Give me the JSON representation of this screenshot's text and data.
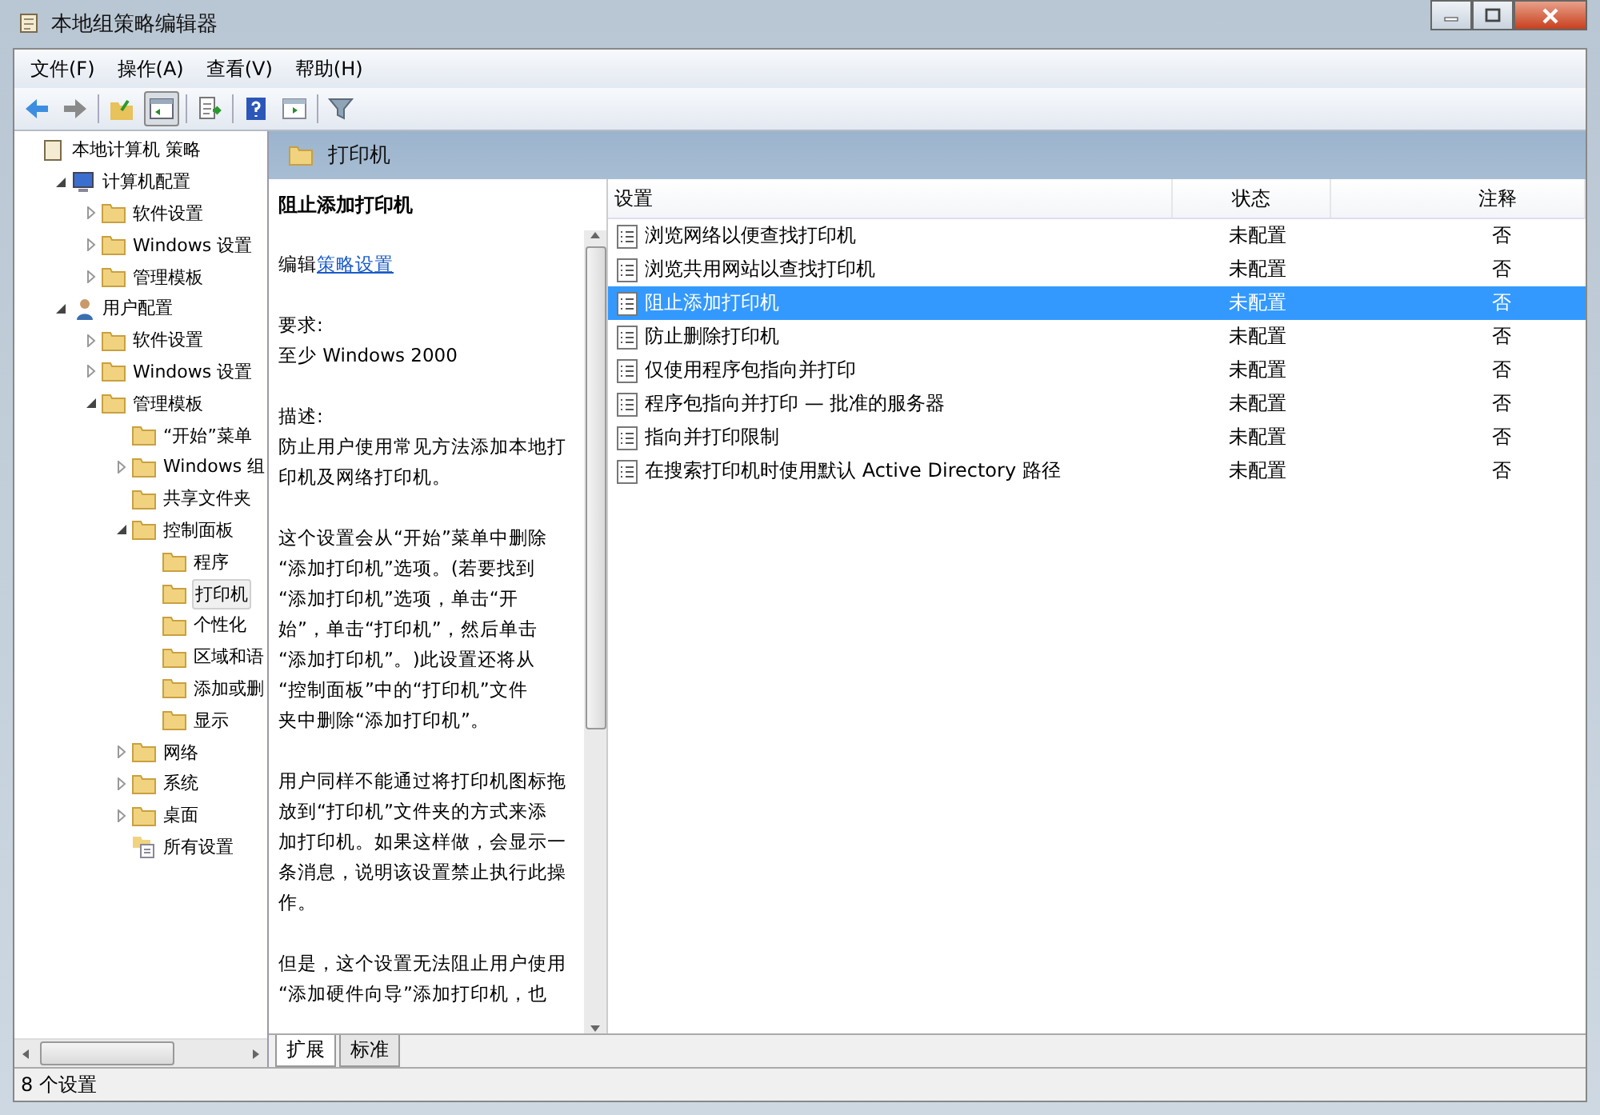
{
  "window": {
    "title": "本地组策略编辑器"
  },
  "menu": [
    "文件(F)",
    "操作(A)",
    "查看(V)",
    "帮助(H)"
  ],
  "tree": [
    {
      "label": "本地计算机 策略",
      "kind": "root",
      "selected": false,
      "children": [
        {
          "label": "计算机配置",
          "kind": "computer",
          "selected": false,
          "expanded": true,
          "children": [
            {
              "label": "软件设置",
              "kind": "folder",
              "selected": false,
              "expanded": false
            },
            {
              "label": "Windows 设置",
              "kind": "folder",
              "selected": false,
              "expanded": false
            },
            {
              "label": "管理模板",
              "kind": "folder",
              "selected": false,
              "expanded": false
            }
          ]
        },
        {
          "label": "用户配置",
          "kind": "user",
          "selected": false,
          "expanded": true,
          "children": [
            {
              "label": "软件设置",
              "kind": "folder",
              "selected": false,
              "expanded": false
            },
            {
              "label": "Windows 设置",
              "kind": "folder",
              "selected": false,
              "expanded": false
            },
            {
              "label": "管理模板",
              "kind": "folder",
              "selected": false,
              "expanded": true,
              "children": [
                {
                  "label": "“开始”菜单",
                  "kind": "folder",
                  "selected": false
                },
                {
                  "label": "Windows 组",
                  "kind": "folder",
                  "selected": false,
                  "expanded": false
                },
                {
                  "label": "共享文件夹",
                  "kind": "folder",
                  "selected": false
                },
                {
                  "label": "控制面板",
                  "kind": "folder",
                  "selected": false,
                  "expanded": true,
                  "children": [
                    {
                      "label": "程序",
                      "kind": "folder",
                      "selected": false
                    },
                    {
                      "label": "打印机",
                      "kind": "folder",
                      "selected": true
                    },
                    {
                      "label": "个性化",
                      "kind": "folder",
                      "selected": false
                    },
                    {
                      "label": "区域和语",
                      "kind": "folder",
                      "selected": false
                    },
                    {
                      "label": "添加或删",
                      "kind": "folder",
                      "selected": false
                    },
                    {
                      "label": "显示",
                      "kind": "folder",
                      "selected": false
                    }
                  ]
                },
                {
                  "label": "网络",
                  "kind": "folder",
                  "selected": false,
                  "expanded": false
                },
                {
                  "label": "系统",
                  "kind": "folder",
                  "selected": false,
                  "expanded": false
                },
                {
                  "label": "桌面",
                  "kind": "folder",
                  "selected": false,
                  "expanded": false
                },
                {
                  "label": "所有设置",
                  "kind": "all",
                  "selected": false
                }
              ]
            }
          ]
        }
      ]
    }
  ],
  "header": {
    "title": "打印机"
  },
  "description": {
    "title": "阻止添加打印机",
    "edit_prefix": "编辑",
    "edit_link": "策略设置",
    "paragraphs": [
      [
        "要求:",
        "至少 Windows 2000"
      ],
      [
        "描述:",
        "防止用户使用常见方法添加本地打",
        "印机及网络打印机。"
      ],
      [
        "这个设置会从“开始”菜单中删除",
        "“添加打印机”选项。(若要找到",
        "“添加打印机”选项，单击“开",
        "始”，单击“打印机”，然后单击",
        "“添加打印机”。)此设置还将从",
        "“控制面板”中的“打印机”文件",
        "夹中删除“添加打印机”。"
      ],
      [
        "用户同样不能通过将打印机图标拖",
        "放到“打印机”文件夹的方式来添",
        "加打印机。如果这样做，会显示一",
        "条消息，说明该设置禁止执行此操",
        "作。"
      ],
      [
        "但是，这个设置无法阻止用户使用",
        "“添加硬件向导”添加打印机，也"
      ]
    ]
  },
  "table": {
    "columns": [
      "设置",
      "状态",
      "注释"
    ],
    "rows": [
      {
        "name": "浏览网络以便查找打印机",
        "state": "未配置",
        "note": "否",
        "selected": false
      },
      {
        "name": "浏览共用网站以查找打印机",
        "state": "未配置",
        "note": "否",
        "selected": false
      },
      {
        "name": "阻止添加打印机",
        "state": "未配置",
        "note": "否",
        "selected": true
      },
      {
        "name": "防止删除打印机",
        "state": "未配置",
        "note": "否",
        "selected": false
      },
      {
        "name": "仅使用程序包指向并打印",
        "state": "未配置",
        "note": "否",
        "selected": false
      },
      {
        "name": "程序包指向并打印 — 批准的服务器",
        "state": "未配置",
        "note": "否",
        "selected": false
      },
      {
        "name": "指向并打印限制",
        "state": "未配置",
        "note": "否",
        "selected": false
      },
      {
        "name": "在搜索打印机时使用默认 Active Directory 路径",
        "state": "未配置",
        "note": "否",
        "selected": false
      }
    ]
  },
  "tabs": [
    {
      "label": "扩展",
      "selected": true
    },
    {
      "label": "标准",
      "selected": false
    }
  ],
  "status_bar": "8 个设置"
}
